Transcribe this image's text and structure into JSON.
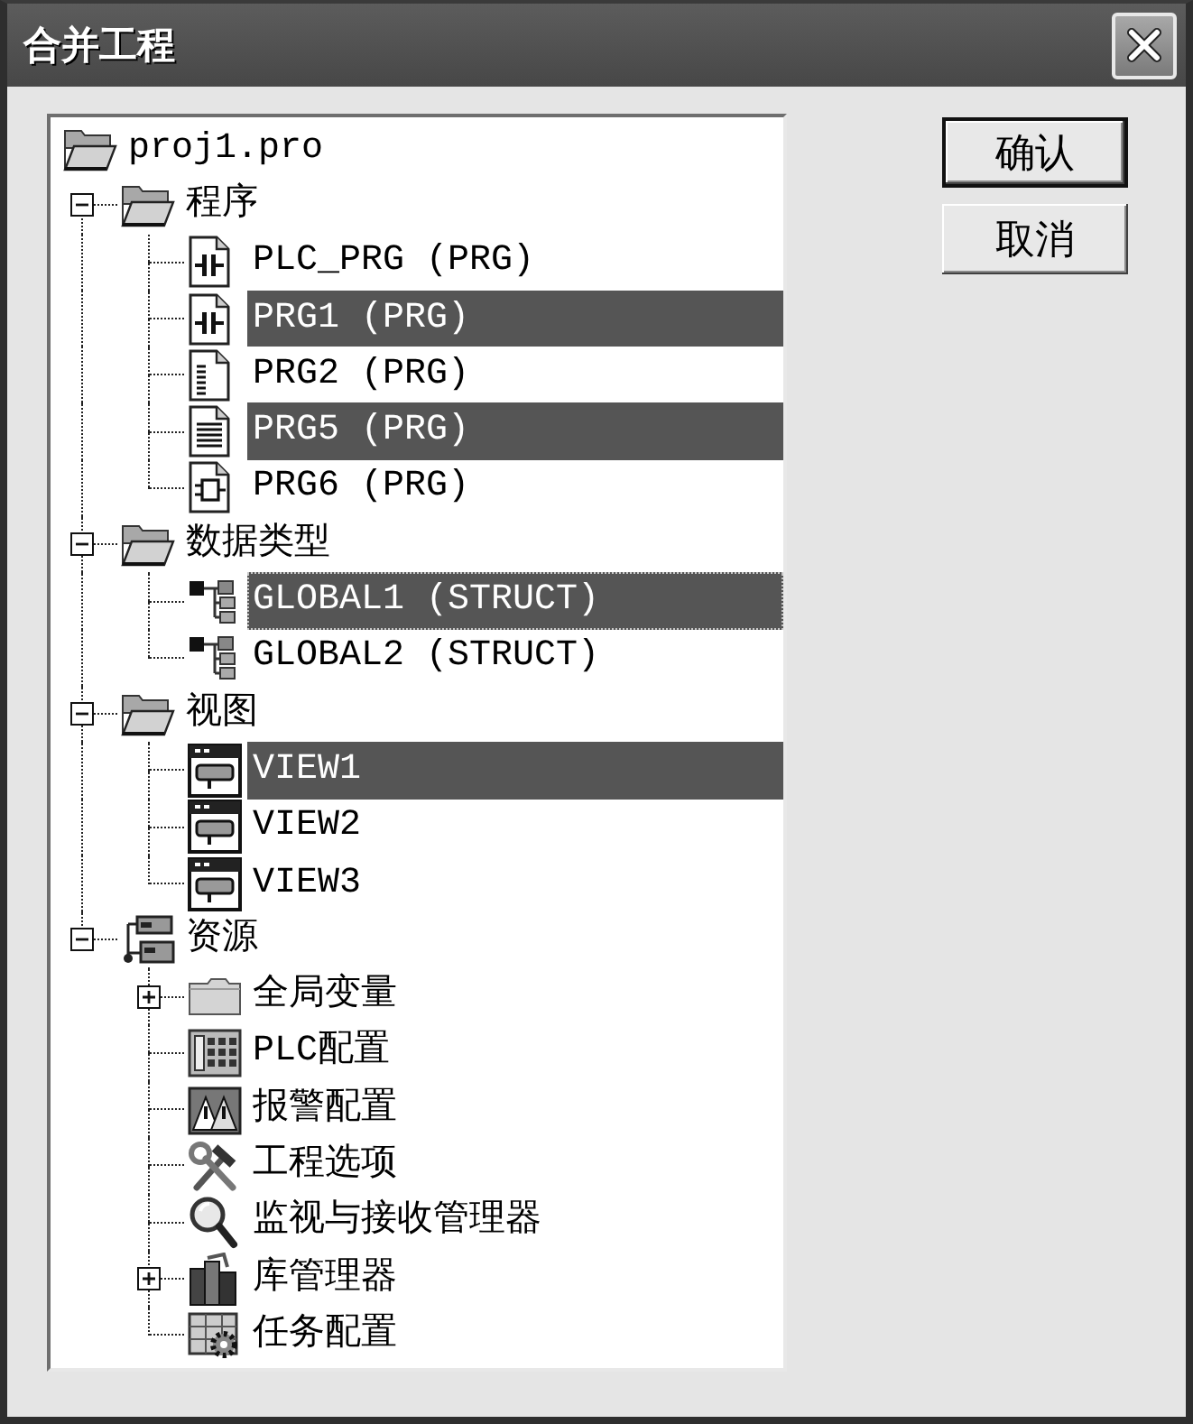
{
  "window": {
    "title": "合并工程"
  },
  "project_tree": [
    {
      "label": "proj1.pro",
      "kind": "folder",
      "selected": false,
      "focused": false,
      "children": [
        {
          "label": "程序",
          "kind": "folder",
          "expanded": true,
          "selected": false,
          "focused": false,
          "children": [
            {
              "label": "PLC_PRG (PRG)",
              "kind": "ladder",
              "selected": false,
              "focused": false
            },
            {
              "label": "PRG1 (PRG)",
              "kind": "ladder",
              "selected": true,
              "focused": false
            },
            {
              "label": "PRG2 (PRG)",
              "kind": "listing",
              "selected": false,
              "focused": false
            },
            {
              "label": "PRG5 (PRG)",
              "kind": "text",
              "selected": true,
              "focused": false
            },
            {
              "label": "PRG6 (PRG)",
              "kind": "blocks",
              "selected": false,
              "focused": false
            }
          ]
        },
        {
          "label": "数据类型",
          "kind": "folder",
          "expanded": true,
          "selected": false,
          "focused": false,
          "children": [
            {
              "label": "GLOBAL1 (STRUCT)",
              "kind": "struct",
              "selected": true,
              "focused": true
            },
            {
              "label": "GLOBAL2 (STRUCT)",
              "kind": "struct",
              "selected": false,
              "focused": false
            }
          ]
        },
        {
          "label": "视图",
          "kind": "folder",
          "expanded": true,
          "selected": false,
          "focused": false,
          "children": [
            {
              "label": "VIEW1",
              "kind": "visual",
              "selected": true,
              "focused": false
            },
            {
              "label": "VIEW2",
              "kind": "visual",
              "selected": false,
              "focused": false
            },
            {
              "label": "VIEW3",
              "kind": "visual",
              "selected": false,
              "focused": false
            }
          ]
        },
        {
          "label": "资源",
          "kind": "resources",
          "expanded": true,
          "selected": false,
          "focused": false,
          "children": [
            {
              "label": "全局变量",
              "kind": "folder",
              "expanded": false,
              "selected": false,
              "focused": false
            },
            {
              "label": "PLC配置",
              "kind": "plc",
              "selected": false,
              "focused": false
            },
            {
              "label": "报警配置",
              "kind": "alarm",
              "selected": false,
              "focused": false
            },
            {
              "label": "工程选项",
              "kind": "tools",
              "selected": false,
              "focused": false
            },
            {
              "label": "监视与接收管理器",
              "kind": "monitor",
              "selected": false,
              "focused": false
            },
            {
              "label": "库管理器",
              "kind": "library",
              "expanded": false,
              "selected": false,
              "focused": false
            },
            {
              "label": "任务配置",
              "kind": "tasks",
              "selected": false,
              "focused": false
            }
          ]
        }
      ]
    }
  ],
  "buttons": [
    {
      "label": "确认",
      "default": true
    },
    {
      "label": "取消",
      "default": false
    }
  ]
}
